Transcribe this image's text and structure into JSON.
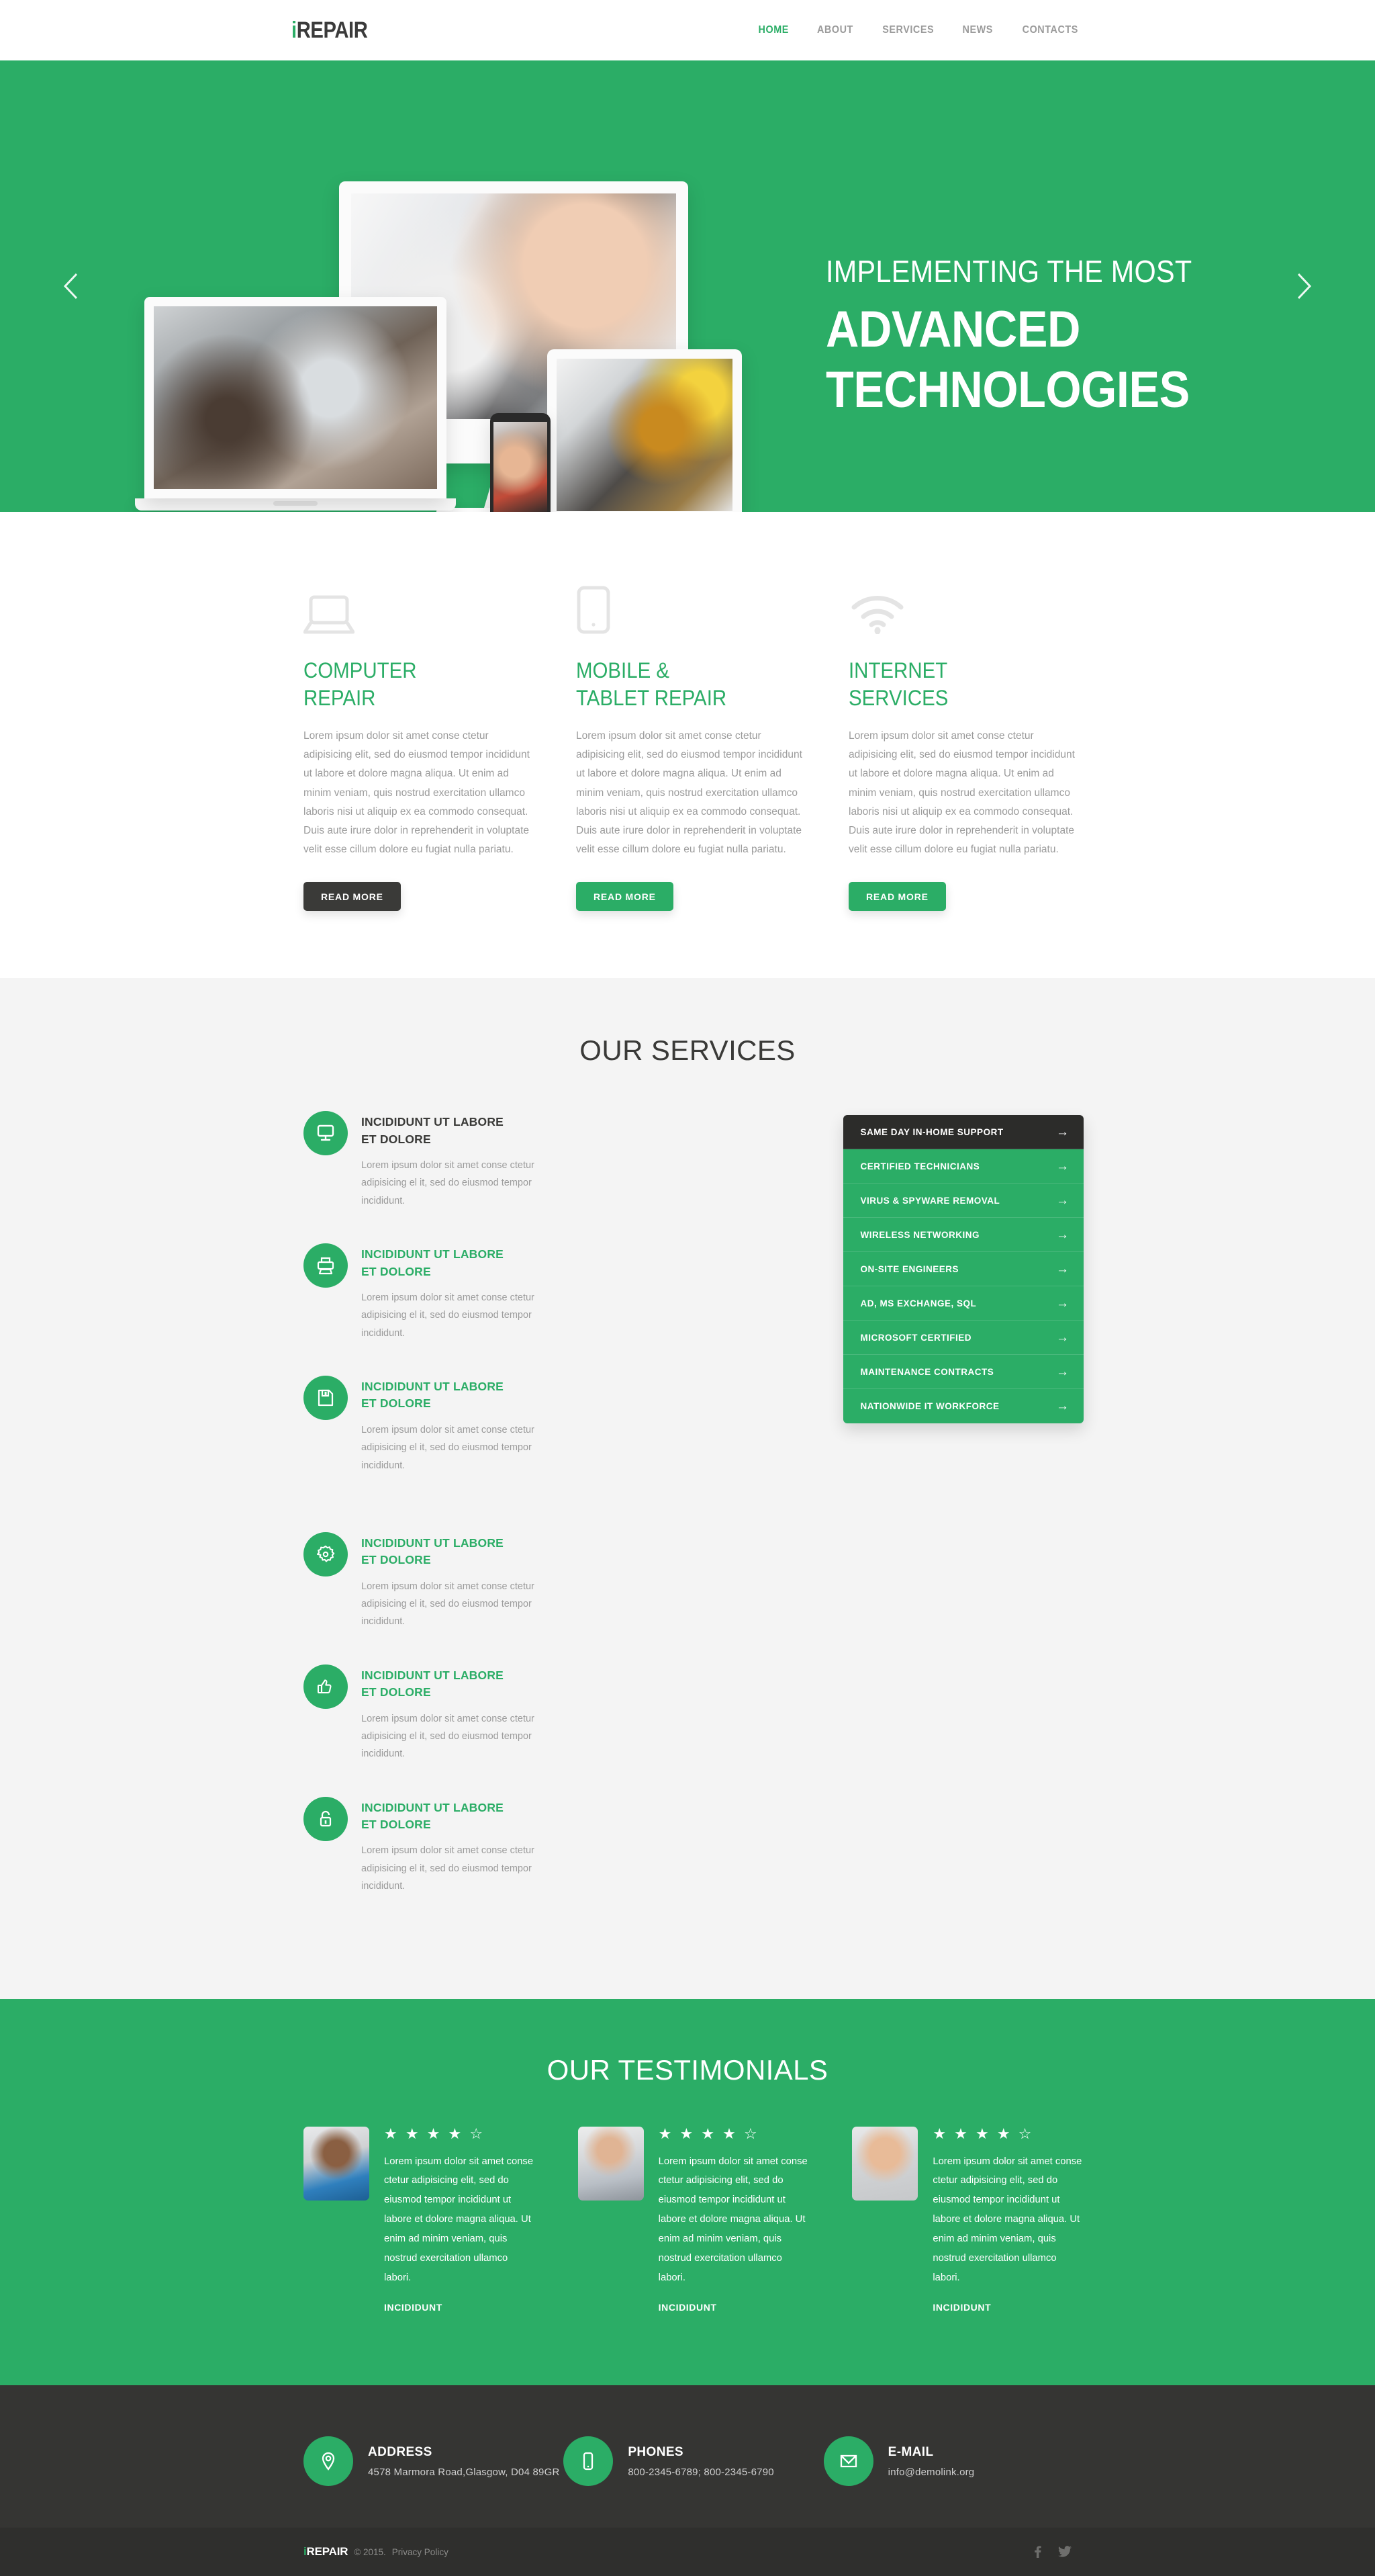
{
  "brand": {
    "logo_i": "i",
    "logo_rest": "REPAIR",
    "accent_color": "#2bad66",
    "dark_color": "#3a3a38"
  },
  "nav": {
    "items": [
      {
        "label": "HOME",
        "active": true
      },
      {
        "label": "ABOUT",
        "active": false
      },
      {
        "label": "SERVICES",
        "active": false
      },
      {
        "label": "NEWS",
        "active": false
      },
      {
        "label": "CONTACTS",
        "active": false
      }
    ]
  },
  "hero": {
    "kicker": "IMPLEMENTING THE MOST",
    "title_line1": "ADVANCED",
    "title_line2": "TECHNOLOGIES",
    "prev_icon": "chevron-left-icon",
    "next_icon": "chevron-right-icon"
  },
  "features": {
    "items": [
      {
        "icon": "laptop-icon",
        "title_line1": "COMPUTER",
        "title_line2": "REPAIR",
        "text": "Lorem ipsum dolor sit amet conse ctetur adipisicing elit, sed do eiusmod tempor incididunt ut labore et dolore magna aliqua. Ut enim ad minim veniam, quis nostrud exercitation ullamco laboris nisi ut aliquip ex ea commodo consequat. Duis aute irure dolor in reprehenderit in voluptate velit esse cillum dolore eu fugiat nulla pariatu.",
        "button": "READ MORE",
        "button_style": "dark"
      },
      {
        "icon": "tablet-icon",
        "title_line1": "MOBILE &",
        "title_line2": "TABLET REPAIR",
        "text": "Lorem ipsum dolor sit amet conse ctetur adipisicing elit, sed do eiusmod tempor incididunt ut labore et dolore magna aliqua. Ut enim ad minim veniam, quis nostrud exercitation ullamco laboris nisi ut aliquip ex ea commodo consequat. Duis aute irure dolor in reprehenderit in voluptate velit esse cillum dolore eu fugiat nulla pariatu.",
        "button": "READ MORE",
        "button_style": "green"
      },
      {
        "icon": "wifi-icon",
        "title_line1": "INTERNET",
        "title_line2": "SERVICES",
        "text": "Lorem ipsum dolor sit amet conse ctetur adipisicing elit, sed do eiusmod tempor incididunt ut labore et dolore magna aliqua. Ut enim ad minim veniam, quis nostrud exercitation ullamco laboris nisi ut aliquip ex ea commodo consequat. Duis aute irure dolor in reprehenderit in voluptate velit esse cillum dolore eu fugiat nulla pariatu.",
        "button": "READ MORE",
        "button_style": "green"
      }
    ]
  },
  "services": {
    "title": "OUR SERVICES",
    "body_text": "Lorem ipsum dolor sit amet conse ctetur adipisicing el it, sed do eiusmod tempor incididunt.",
    "items": [
      {
        "icon": "monitor-icon",
        "title_line1": "INCIDIDUNT UT LABORE",
        "title_line2": "ET DOLORE",
        "text": "Lorem ipsum dolor sit amet conse ctetur adipisicing el it, sed do eiusmod tempor incididunt.",
        "highlight": false
      },
      {
        "icon": "gear-icon",
        "title_line1": "INCIDIDUNT UT LABORE",
        "title_line2": "ET DOLORE",
        "text": "Lorem ipsum dolor sit amet conse ctetur adipisicing el it, sed do eiusmod tempor incididunt.",
        "highlight": true
      },
      {
        "icon": "printer-icon",
        "title_line1": "INCIDIDUNT UT LABORE",
        "title_line2": "ET DOLORE",
        "text": "Lorem ipsum dolor sit amet conse ctetur adipisicing el it, sed do eiusmod tempor incididunt.",
        "highlight": true
      },
      {
        "icon": "thumbs-up-icon",
        "title_line1": "INCIDIDUNT UT LABORE",
        "title_line2": "ET DOLORE",
        "text": "Lorem ipsum dolor sit amet conse ctetur adipisicing el it, sed do eiusmod tempor incididunt.",
        "highlight": true
      },
      {
        "icon": "save-icon",
        "title_line1": "INCIDIDUNT UT LABORE",
        "title_line2": "ET DOLORE",
        "text": "Lorem ipsum dolor sit amet conse ctetur adipisicing el it, sed do eiusmod tempor incididunt.",
        "highlight": true
      },
      {
        "icon": "lock-icon",
        "title_line1": "INCIDIDUNT UT LABORE",
        "title_line2": "ET DOLORE",
        "text": "Lorem ipsum dolor sit amet conse ctetur adipisicing el it, sed do eiusmod tempor incididunt.",
        "highlight": true
      }
    ],
    "list": [
      {
        "label": "SAME DAY IN-HOME SUPPORT",
        "active": true
      },
      {
        "label": "CERTIFIED TECHNICIANS",
        "active": false
      },
      {
        "label": "VIRUS & SPYWARE REMOVAL",
        "active": false
      },
      {
        "label": "WIRELESS NETWORKING",
        "active": false
      },
      {
        "label": "ON-SITE ENGINEERS",
        "active": false
      },
      {
        "label": "AD, MS EXCHANGE, SQL",
        "active": false
      },
      {
        "label": "MICROSOFT CERTIFIED",
        "active": false
      },
      {
        "label": "MAINTENANCE CONTRACTS",
        "active": false
      },
      {
        "label": "NATIONWIDE IT WORKFORCE",
        "active": false
      }
    ],
    "list_arrow_icon": "arrow-right-icon"
  },
  "testimonials": {
    "title": "OUR TESTIMONIALS",
    "items": [
      {
        "avatar": "avatar-man-blue-polo",
        "rating_filled": 4,
        "rating_total": 5,
        "stars": "★ ★ ★ ★ ☆",
        "text": "Lorem ipsum dolor sit amet conse ctetur adipisicing elit, sed do eiusmod tempor incididunt ut labore et dolore magna aliqua. Ut enim ad minim veniam, quis nostrud exercitation ullamco labori.",
        "name": "INCIDIDUNT"
      },
      {
        "avatar": "avatar-man-striped-shirt",
        "rating_filled": 4,
        "rating_total": 5,
        "stars": "★ ★ ★ ★ ☆",
        "text": "Lorem ipsum dolor sit amet conse ctetur adipisicing elit, sed do eiusmod tempor incididunt ut labore et dolore magna aliqua. Ut enim ad minim veniam, quis nostrud exercitation ullamco labori.",
        "name": "INCIDIDUNT"
      },
      {
        "avatar": "avatar-man-smiling",
        "rating_filled": 4,
        "rating_total": 5,
        "stars": "★ ★ ★ ★ ☆",
        "text": "Lorem ipsum dolor sit amet conse ctetur adipisicing elit, sed do eiusmod tempor incididunt ut labore et dolore magna aliqua. Ut enim ad minim veniam, quis nostrud exercitation ullamco labori.",
        "name": "INCIDIDUNT"
      }
    ]
  },
  "footer": {
    "contacts": [
      {
        "icon": "map-pin-icon",
        "label": "ADDRESS",
        "value": "4578 Marmora Road,Glasgow, D04 89GR"
      },
      {
        "icon": "phone-icon",
        "label": "PHONES",
        "value": "800-2345-6789;  800-2345-6790"
      },
      {
        "icon": "envelope-icon",
        "label": "E-MAIL",
        "value": "info@demolink.org"
      }
    ],
    "copyright": "© 2015.",
    "privacy": "Privacy Policy",
    "socials": [
      {
        "icon": "facebook-icon",
        "label": "f"
      },
      {
        "icon": "twitter-icon",
        "label": "t"
      }
    ]
  }
}
